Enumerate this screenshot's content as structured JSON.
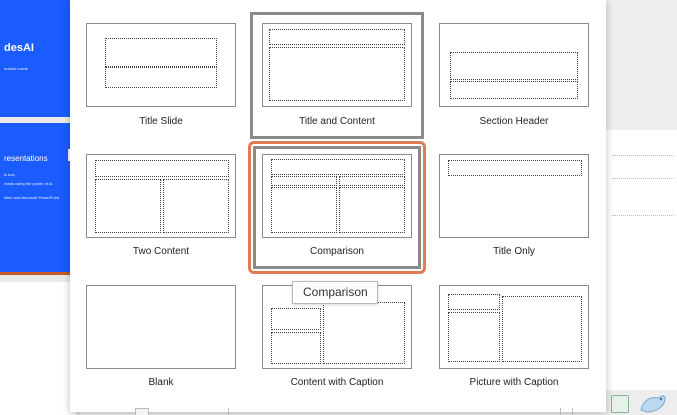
{
  "slides": {
    "thumb1": {
      "title": "desAI",
      "subtitle": "eration inside"
    },
    "thumb2": {
      "title": "resentations",
      "lines": [
        "ls tool.",
        "reads using the power of AI.",
        "lides and Microsoft PowerPoint."
      ]
    }
  },
  "layouts": [
    {
      "name": "Title Slide",
      "kind": "title-slide"
    },
    {
      "name": "Title and Content",
      "kind": "title-content",
      "selected": true
    },
    {
      "name": "Section Header",
      "kind": "section-header"
    },
    {
      "name": "Two Content",
      "kind": "two-content"
    },
    {
      "name": "Comparison",
      "kind": "comparison",
      "hovered": true
    },
    {
      "name": "Title Only",
      "kind": "title-only"
    },
    {
      "name": "Blank",
      "kind": "blank"
    },
    {
      "name": "Content with Caption",
      "kind": "content-caption"
    },
    {
      "name": "Picture with Caption",
      "kind": "picture-caption"
    }
  ],
  "tooltip": {
    "text": "Comparison"
  },
  "colors": {
    "slide_blue": "#1a5cff",
    "selection_gray": "#8a8a8a",
    "hover_orange": "#e07c55"
  },
  "icons": {
    "bottom_left": "notes-icon",
    "bottom_right": "designer-bird-icon"
  }
}
